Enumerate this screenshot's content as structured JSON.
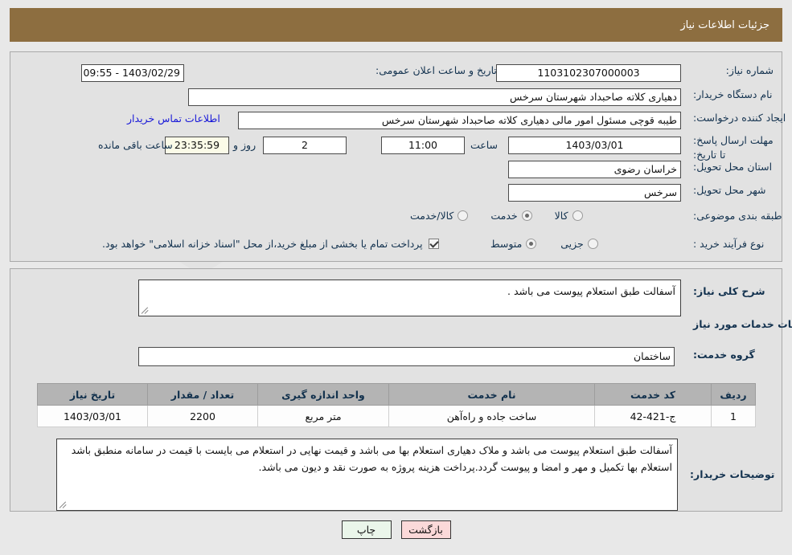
{
  "header": {
    "title": "جزئیات اطلاعات نیاز",
    "bar_color": "#8d6e40"
  },
  "watermark": {
    "text": "AriaTender.net"
  },
  "fields": {
    "need_number_label": "شماره نیاز:",
    "need_number_value": "1103102307000003",
    "announce_label": "تاریخ و ساعت اعلان عمومی:",
    "announce_value": "1403/02/29 - 09:55",
    "buyer_org_label": "نام دستگاه خریدار:",
    "buyer_org_value": "دهیاری کلاته صاحبداد شهرستان سرخس",
    "requester_label": "ایجاد کننده درخواست:",
    "requester_value": "طیبه قوچی مسئول امور مالی دهیاری کلاته صاحبداد شهرستان سرخس",
    "contact_link": "اطلاعات تماس خریدار",
    "deadline_label": "مهلت ارسال پاسخ: تا تاریخ:",
    "deadline_date": "1403/03/01",
    "hour_label": "ساعت",
    "deadline_time": "11:00",
    "days_remaining": "2",
    "days_label": "روز و",
    "countdown": "23:35:59",
    "countdown_label": "ساعت باقی مانده",
    "province_label": "استان محل تحویل:",
    "province_value": "خراسان رضوی",
    "city_label": "شهر محل تحویل:",
    "city_value": "سرخس",
    "category_label": "طبقه بندی موضوعی:",
    "purchase_type_label": "نوع فرآیند خرید :",
    "treasury_note": "پرداخت تمام یا بخشی از مبلغ خرید،از محل \"اسناد خزانه اسلامی\" خواهد بود."
  },
  "category_options": [
    {
      "label": "کالا",
      "selected": false
    },
    {
      "label": "خدمت",
      "selected": true
    },
    {
      "label": "کالا/خدمت",
      "selected": false
    }
  ],
  "purchase_options": [
    {
      "label": "جزیی",
      "selected": false
    },
    {
      "label": "متوسط",
      "selected": true
    }
  ],
  "treasury_checked": true,
  "description": {
    "general_label": "شرح کلی نیاز:",
    "general_value": "آسفالت طبق استعلام پیوست می باشد .",
    "section_title": "اطلاعات خدمات مورد نیاز",
    "service_group_label": "گروه خدمت:",
    "service_group_value": "ساختمان"
  },
  "table": {
    "columns": [
      "ردیف",
      "کد خدمت",
      "نام خدمت",
      "واحد اندازه گیری",
      "تعداد / مقدار",
      "تاریخ نیاز"
    ],
    "rows": [
      {
        "index": "1",
        "code": "ج-421-42",
        "name": "ساخت جاده و راه‌آهن",
        "unit": "متر مربع",
        "quantity": "2200",
        "date": "1403/03/01"
      }
    ]
  },
  "buyer_notes": {
    "label": "توضیحات خریدار:",
    "value": "آسفالت طبق استعلام پیوست می باشد و ملاک دهیاری استعلام بها می باشد و قیمت نهایی در استعلام می بایست با قیمت در سامانه منطبق باشد استعلام بها تکمیل و مهر و امضا و پیوست گردد.پرداخت هزینه پروژه به صورت نقد و دیون می باشد."
  },
  "buttons": {
    "print": "چاپ",
    "back": "بازگشت"
  }
}
